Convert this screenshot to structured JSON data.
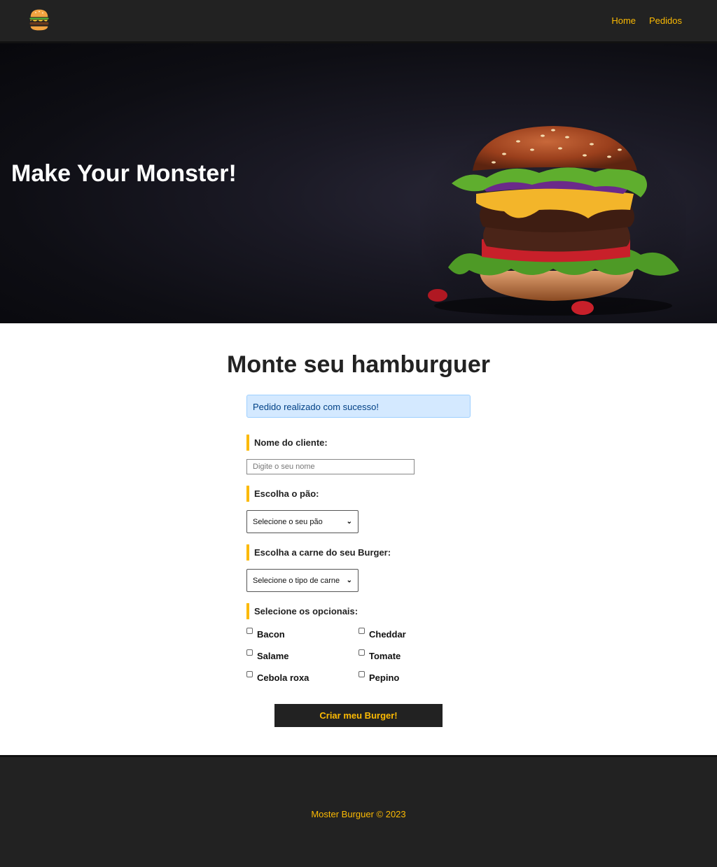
{
  "nav": {
    "logo_icon": "burger-logo-icon",
    "links": [
      "Home",
      "Pedidos"
    ]
  },
  "hero": {
    "title": "Make Your Monster!",
    "image_icon": "burger-photo"
  },
  "main": {
    "title": "Monte seu hamburguer",
    "alert": "Pedido realizado com sucesso!",
    "form": {
      "name_label": "Nome do cliente:",
      "name_placeholder": "Digite o seu nome",
      "bread_label": "Escolha o pão:",
      "bread_selected": "Selecione o seu pão",
      "meat_label": "Escolha a carne do seu Burger:",
      "meat_selected": "Selecione o tipo de carne",
      "optionals_label": "Selecione os opcionais:",
      "optionals": [
        "Bacon",
        "Cheddar",
        "Salame",
        "Tomate",
        "Cebola roxa",
        "Pepino"
      ],
      "submit": "Criar meu Burger!"
    }
  },
  "footer": {
    "text": "Moster Burguer © 2023"
  },
  "colors": {
    "accent": "#fcba03",
    "dark": "#222222",
    "alert_bg": "#d4e9ff",
    "alert_text": "#004085"
  }
}
